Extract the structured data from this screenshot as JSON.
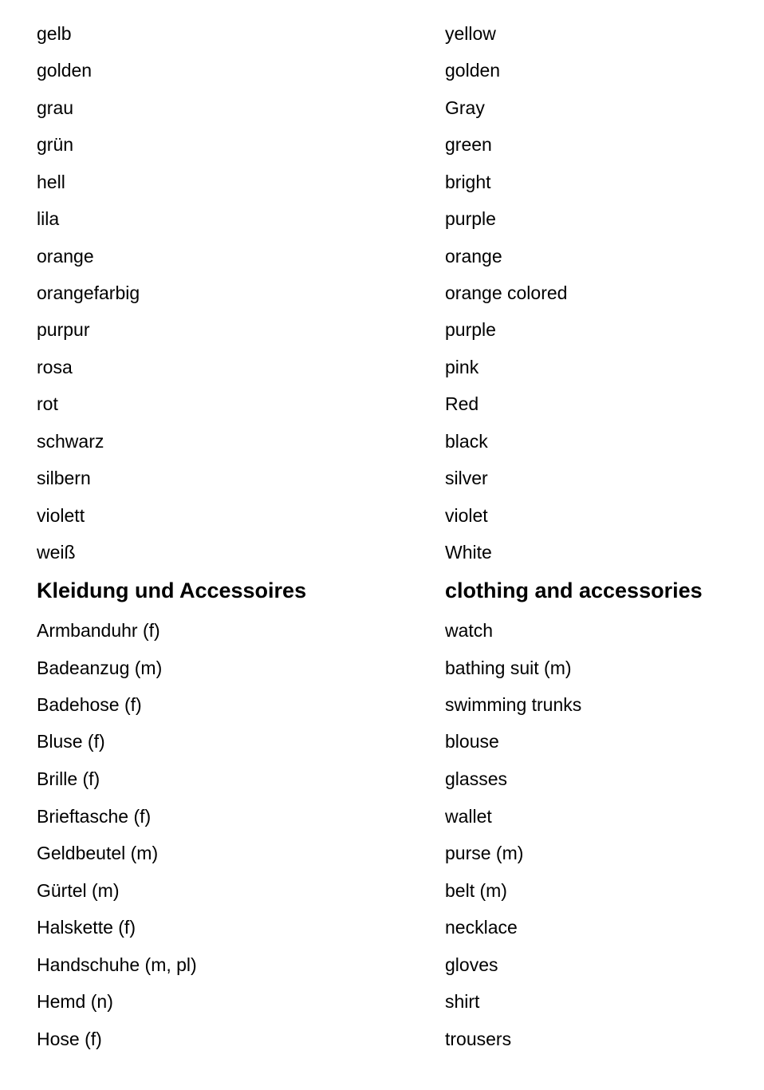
{
  "sections": [
    {
      "heading": null,
      "rows": [
        {
          "de": "gelb",
          "en": "yellow"
        },
        {
          "de": "golden",
          "en": "golden"
        },
        {
          "de": "grau",
          "en": "Gray"
        },
        {
          "de": "grün",
          "en": "green"
        },
        {
          "de": "hell",
          "en": "bright"
        },
        {
          "de": "lila",
          "en": "purple"
        },
        {
          "de": "orange",
          "en": "orange"
        },
        {
          "de": "orangefarbig",
          "en": "orange colored"
        },
        {
          "de": "purpur",
          "en": "purple"
        },
        {
          "de": "rosa",
          "en": "pink"
        },
        {
          "de": "rot",
          "en": "Red"
        },
        {
          "de": "schwarz",
          "en": "black"
        },
        {
          "de": "silbern",
          "en": "silver"
        },
        {
          "de": "violett",
          "en": "violet"
        },
        {
          "de": "weiß",
          "en": "White"
        }
      ]
    },
    {
      "heading": {
        "de": "Kleidung und Accessoires",
        "en": "clothing and accessories"
      },
      "rows": [
        {
          "de": "Armbanduhr (f)",
          "en": "watch"
        },
        {
          "de": "Badeanzug (m)",
          "en": "bathing suit (m)"
        },
        {
          "de": "Badehose (f)",
          "en": "swimming trunks"
        },
        {
          "de": "Bluse (f)",
          "en": "blouse"
        },
        {
          "de": "Brille (f)",
          "en": "glasses"
        },
        {
          "de": "Brieftasche (f)",
          "en": "wallet"
        },
        {
          "de": "Geldbeutel (m)",
          "en": "purse (m)"
        },
        {
          "de": "Gürtel (m)",
          "en": "belt (m)"
        },
        {
          "de": "Halskette (f)",
          "en": "necklace"
        },
        {
          "de": "Handschuhe (m, pl)",
          "en": "gloves"
        },
        {
          "de": "Hemd (n)",
          "en": "shirt"
        },
        {
          "de": "Hose (f)",
          "en": "trousers"
        }
      ]
    }
  ]
}
